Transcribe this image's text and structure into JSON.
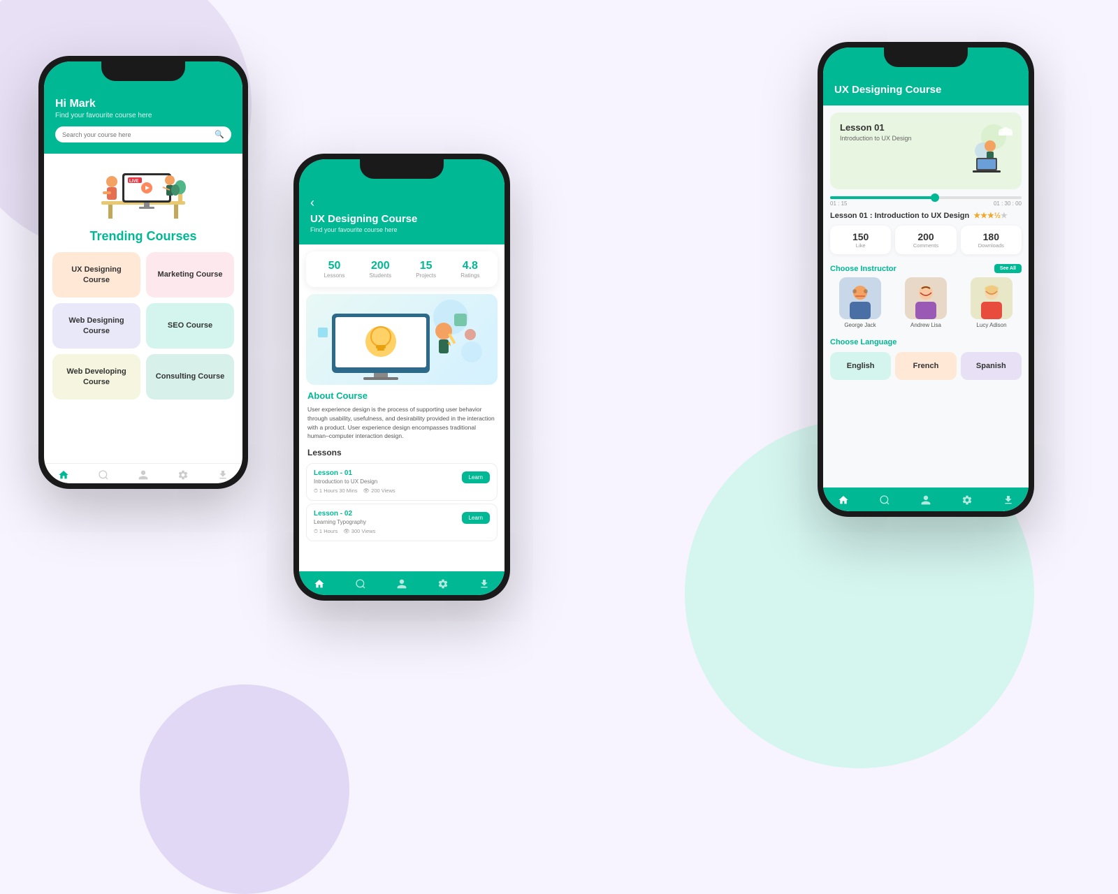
{
  "background": {
    "color": "#f8f4ff"
  },
  "phone1": {
    "header": {
      "greeting": "Hi Mark",
      "subtitle": "Find your favourite course here",
      "search_placeholder": "Search your course here"
    },
    "trending_title": "Trending Courses",
    "courses": [
      {
        "label": "UX Designing Course",
        "color": "peach"
      },
      {
        "label": "Marketing Course",
        "color": "pink"
      },
      {
        "label": "Web Designing Course",
        "color": "lavender"
      },
      {
        "label": "SEO Course",
        "color": "mint"
      },
      {
        "label": "Web Developing Course",
        "color": "light-yellow"
      },
      {
        "label": "Consulting Course",
        "color": "light-mint"
      }
    ],
    "nav": [
      "🏠",
      "🔍",
      "👤",
      "⚙️",
      "⬇️"
    ]
  },
  "phone2": {
    "header": {
      "back": "‹",
      "title": "UX Designing Course",
      "subtitle": "Find your favourite course here"
    },
    "stats": [
      {
        "num": "50",
        "label": "Lessons"
      },
      {
        "num": "200",
        "label": "Students"
      },
      {
        "num": "15",
        "label": "Projects"
      },
      {
        "num": "4.8",
        "label": "Ratings"
      }
    ],
    "about_title": "About Course",
    "about_text": "User experience design is the process of supporting user behavior through usability, usefulness, and desirability provided in the interaction with a product. User experience design encompasses traditional human–computer interaction design.",
    "lessons_title": "Lessons",
    "lessons": [
      {
        "name": "Lesson - 01",
        "sub": "Introduction to UX Design",
        "time": "1 Hours 30 Mins",
        "views": "200 Views",
        "btn": "Learn"
      },
      {
        "name": "Lesson - 02",
        "sub": "Learning Typography",
        "time": "1 Hours",
        "views": "300 Views",
        "btn": "Learn"
      }
    ],
    "nav": [
      "🏠",
      "🔍",
      "👤",
      "⚙️",
      "⬇️"
    ]
  },
  "phone3": {
    "header": {
      "title": "UX Designing Course"
    },
    "video": {
      "title": "Lesson 01",
      "subtitle": "Introduction to UX Design"
    },
    "time_start": "01 : 15",
    "time_end": "01 : 30 : 00",
    "lesson_label": "Lesson 01 : Introduction to UX Design",
    "stars": 3.5,
    "stats": [
      {
        "num": "150",
        "label": "Like"
      },
      {
        "num": "200",
        "label": "Comments"
      },
      {
        "num": "180",
        "label": "Downloads"
      }
    ],
    "choose_instructor": "Choose Instructor",
    "see_all": "See All",
    "instructors": [
      {
        "name": "George Jack",
        "emoji": "👨‍💼"
      },
      {
        "name": "Andrew Lisa",
        "emoji": "👩‍💼"
      },
      {
        "name": "Lucy Adison",
        "emoji": "👱‍♀️"
      }
    ],
    "choose_language": "Choose Language",
    "languages": [
      {
        "label": "English",
        "color": "mint"
      },
      {
        "label": "French",
        "color": "peach"
      },
      {
        "label": "Spanish",
        "color": "lavender"
      }
    ],
    "nav": [
      "🏠",
      "🔍",
      "👤",
      "⚙️",
      "⬇️"
    ]
  }
}
